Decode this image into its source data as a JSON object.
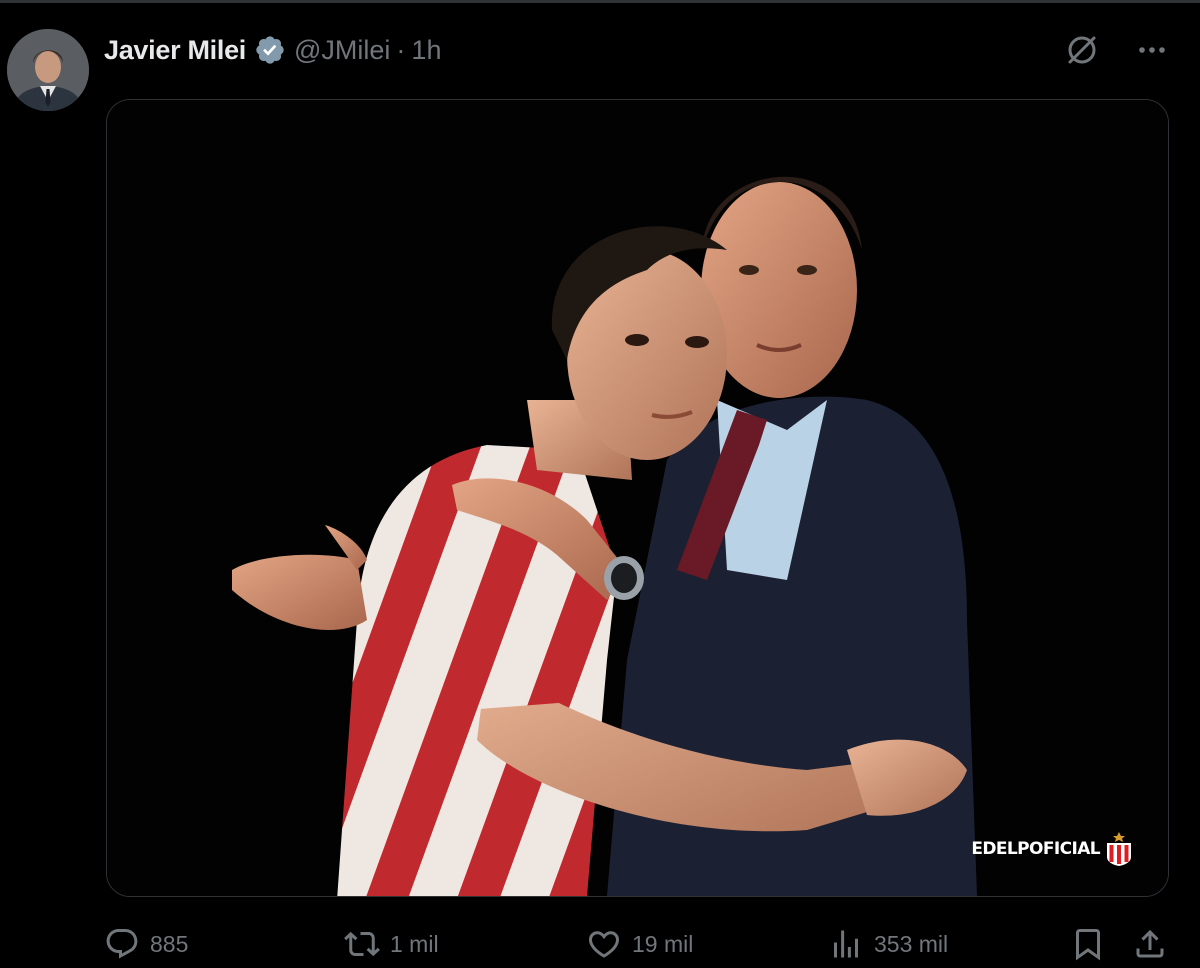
{
  "tweet": {
    "author": {
      "display_name": "Javier Milei",
      "verified": true,
      "handle": "@JMilei",
      "time_sep": "·",
      "time": "1h"
    },
    "header_icons": [
      "grok-icon",
      "more-icon"
    ],
    "media": {
      "watermark": "EDELPOFICIAL"
    },
    "actions": {
      "replies": "885",
      "reposts": "1 mil",
      "likes": "19 mil",
      "views": "353 mil"
    }
  },
  "colors": {
    "background": "#000000",
    "text_primary": "#e7e9ea",
    "text_secondary": "#71767b",
    "verified_badge": "#829aab",
    "border": "#2f3336"
  }
}
